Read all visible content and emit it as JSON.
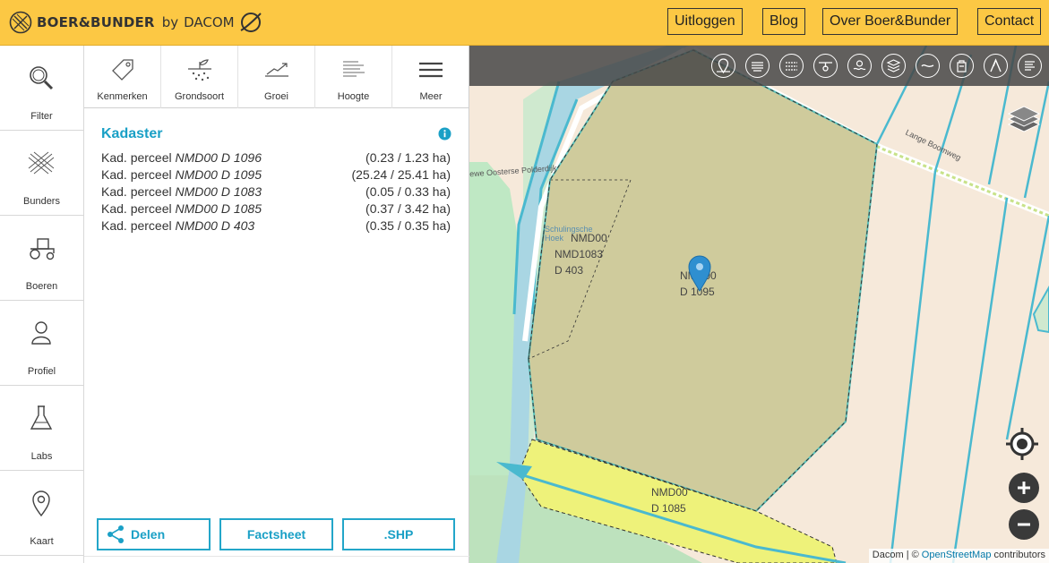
{
  "header": {
    "brand": "BOER&BUNDER",
    "by": "by",
    "company": "DACOM",
    "nav": [
      "Uitloggen",
      "Blog",
      "Over Boer&Bunder",
      "Contact"
    ]
  },
  "rail": {
    "items": [
      {
        "label": "Filter",
        "icon": "search-icon"
      },
      {
        "label": "Bunders",
        "icon": "fields-icon"
      },
      {
        "label": "Boeren",
        "icon": "tractor-icon"
      },
      {
        "label": "Profiel",
        "icon": "user-icon"
      },
      {
        "label": "Labs",
        "icon": "flask-icon"
      },
      {
        "label": "Kaart",
        "icon": "map-pin-icon"
      }
    ]
  },
  "panel": {
    "tabs": [
      {
        "label": "Kenmerken",
        "icon": "tag-icon"
      },
      {
        "label": "Grondsoort",
        "icon": "soil-icon"
      },
      {
        "label": "Groei",
        "icon": "growth-chart-icon"
      },
      {
        "label": "Hoogte",
        "icon": "height-icon"
      },
      {
        "label": "Meer",
        "icon": "menu-icon"
      }
    ],
    "section_title": "Kadaster",
    "parcels": [
      {
        "prefix": "Kad. perceel",
        "id": "NMD00 D 1096",
        "area": "(0.23 / 1.23 ha)"
      },
      {
        "prefix": "Kad. perceel",
        "id": "NMD00 D 1095",
        "area": "(25.24 / 25.41 ha)"
      },
      {
        "prefix": "Kad. perceel",
        "id": "NMD00 D 1083",
        "area": "(0.05 / 0.33 ha)"
      },
      {
        "prefix": "Kad. perceel",
        "id": "NMD00 D 1085",
        "area": "(0.37 / 3.42 ha)"
      },
      {
        "prefix": "Kad. perceel",
        "id": "NMD00 D 403",
        "area": "(0.35 / 0.35 ha)"
      }
    ],
    "buttons": {
      "share": "Delen",
      "factsheet": "Factsheet",
      "shp": ".SHP"
    }
  },
  "map": {
    "toolbar_icons": [
      "location-icon",
      "rain-icon",
      "drainage-icon",
      "drone-icon",
      "water-icon",
      "layers-stack-icon",
      "wave-icon",
      "bag-icon",
      "path-icon",
      "text-lines-icon"
    ],
    "labels": {
      "nmd_a": "NMD00",
      "nmd_b": "NMD1083",
      "nmd_c": "D 403",
      "p1095_a": "NMD00",
      "p1095_b": "D 1095",
      "p1085_a": "NMD00",
      "p1085_b": "D 1085",
      "street1": "Lange Boomweg",
      "street2": "ewe Oosterse Polderdijk",
      "place": "Schulingsche Hoek"
    },
    "attribution": {
      "prefix": "Dacom |",
      "copy": "©",
      "osm": "OpenStreetMap",
      "suffix": "contributors"
    },
    "colors": {
      "accent": "#1aa0c6",
      "header": "#fcc844",
      "field": "#cfcb9c"
    }
  }
}
